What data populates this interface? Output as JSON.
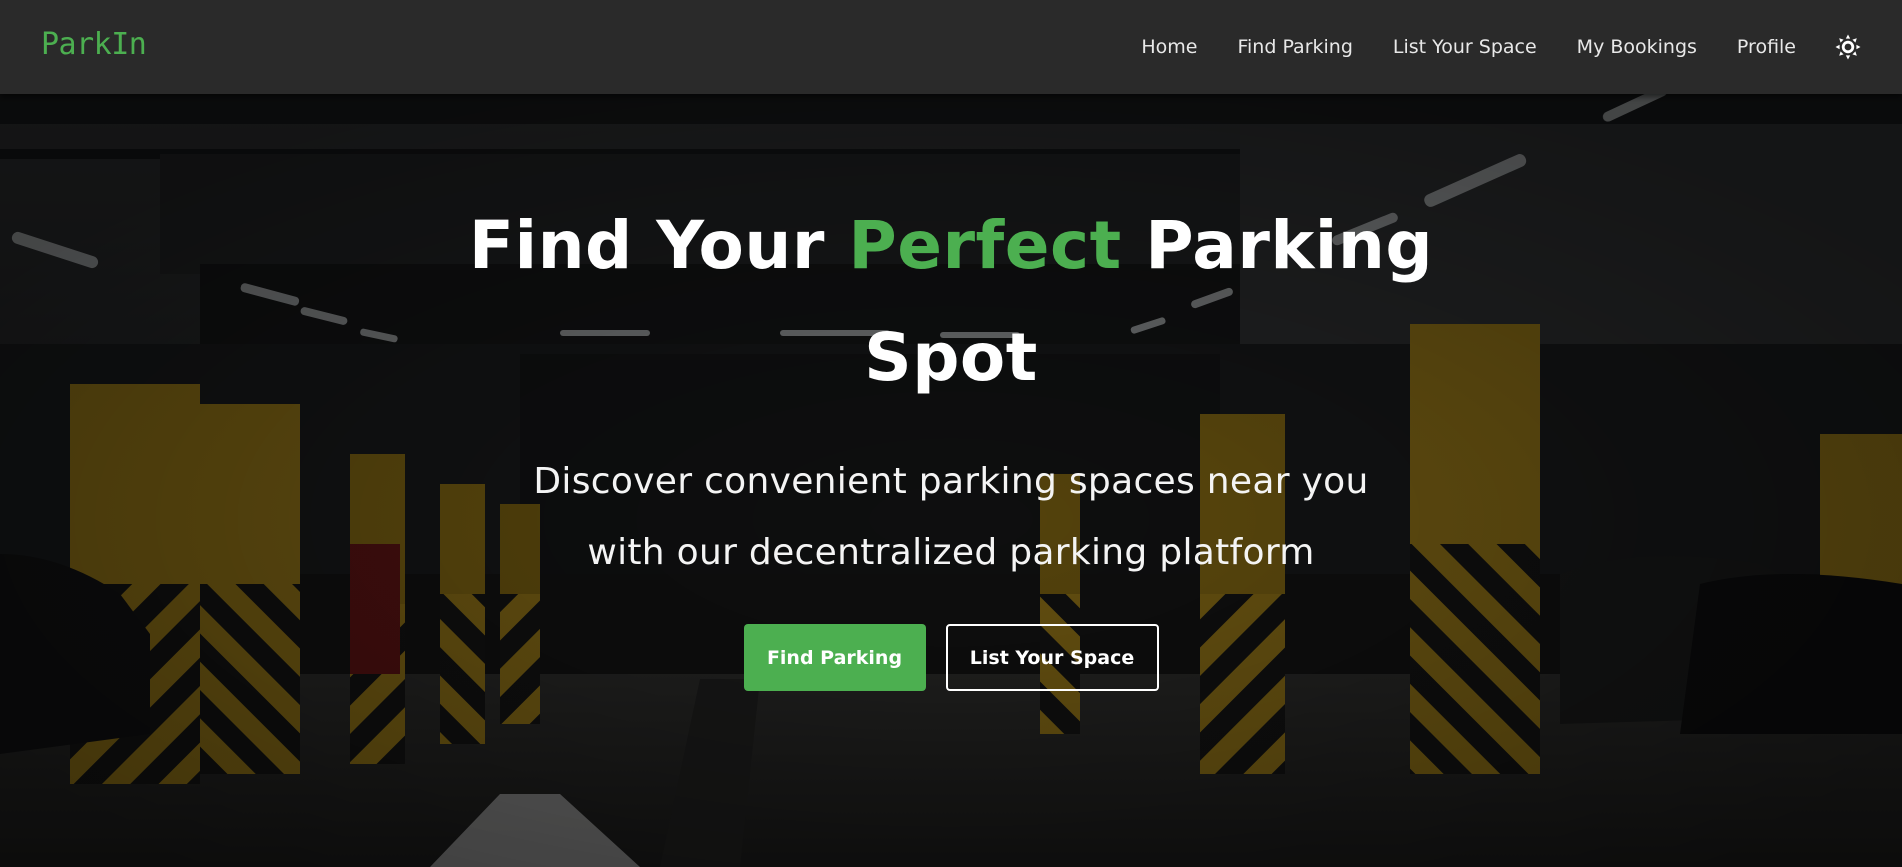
{
  "brand": {
    "name": "ParkIn",
    "color": "#4caf50"
  },
  "nav": {
    "items": [
      {
        "label": "Home"
      },
      {
        "label": "Find Parking"
      },
      {
        "label": "List Your Space"
      },
      {
        "label": "My Bookings"
      },
      {
        "label": "Profile"
      }
    ],
    "theme_toggle_icon": "sun-icon"
  },
  "hero": {
    "title_part1": "Find Your ",
    "title_accent": "Perfect",
    "title_part2": " Parking",
    "title_line2": "Spot",
    "subtitle_line1": "Discover convenient parking spaces near you",
    "subtitle_line2": "with our decentralized parking platform",
    "primary_button": "Find Parking",
    "secondary_button": "List Your Space",
    "background": "underground-parking-garage-photo"
  },
  "colors": {
    "accent": "#4caf50",
    "navbar": "#2a2a2a",
    "text": "#ffffff"
  }
}
